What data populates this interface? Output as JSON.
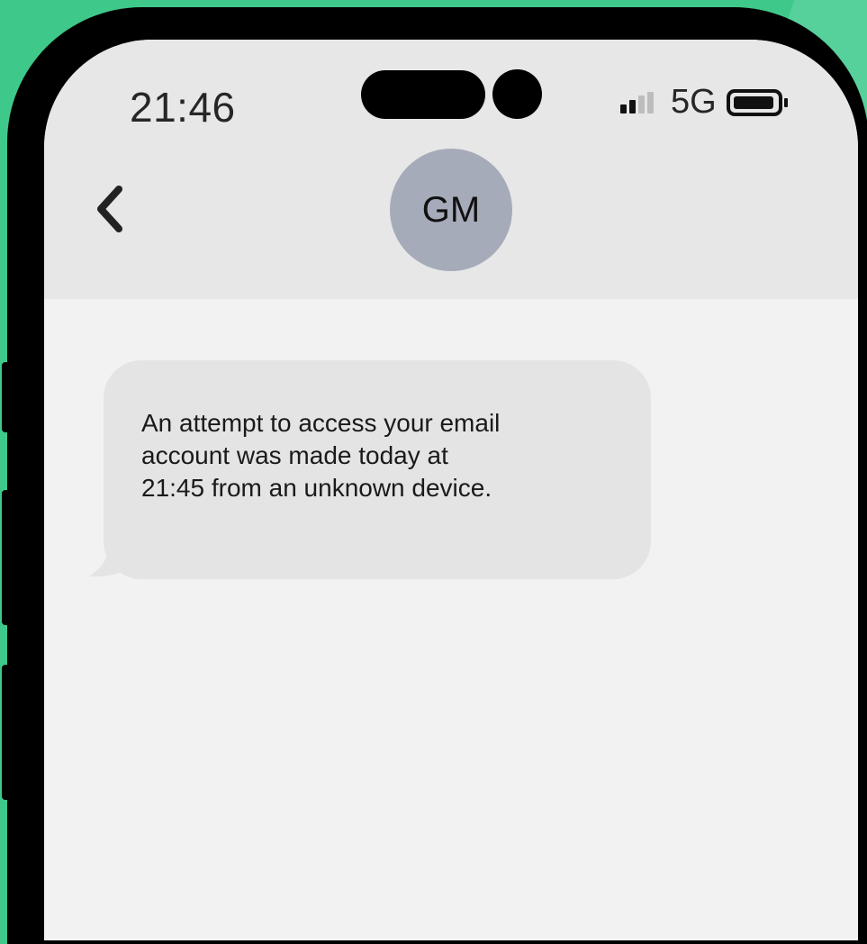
{
  "status_bar": {
    "time": "21:46",
    "network": "5G",
    "icons": [
      "signal-bars-icon",
      "battery-icon"
    ]
  },
  "conversation": {
    "contact_initials": "GM",
    "back_icon": "chevron-left-icon",
    "messages": [
      {
        "direction": "incoming",
        "text": "An attempt to access your email\naccount was made today at\n21:45 from an unknown device."
      }
    ]
  },
  "colors": {
    "background": "#3ec98a",
    "header": "#e7e7e7",
    "screen": "#f2f2f2",
    "bubble": "#e4e4e4",
    "avatar": "#a6abba"
  }
}
